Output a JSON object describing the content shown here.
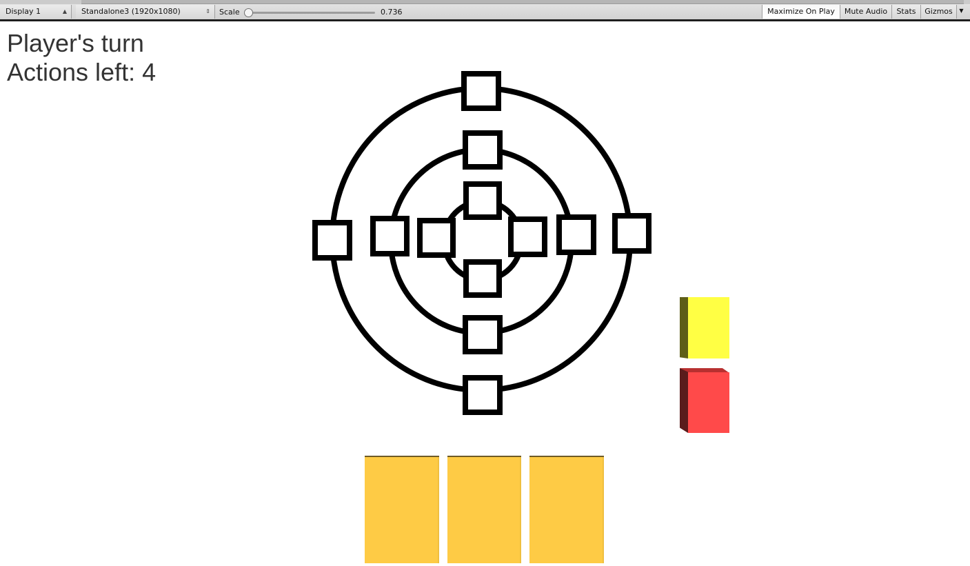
{
  "toolbar": {
    "display_label": "Display 1",
    "resolution_label": "Standalone3 (1920x1080)",
    "scale_label": "Scale",
    "scale_value": "0.736",
    "maximize_label": "Maximize On Play",
    "mute_label": "Mute Audio",
    "stats_label": "Stats",
    "gizmos_label": "Gizmos"
  },
  "hud": {
    "turn_text": "Player's turn",
    "actions_text": "Actions left: 4"
  },
  "colors": {
    "yellow_cube": "#ffff44",
    "red_cube": "#ff4a4a",
    "card": "#fecb45",
    "board_line": "#000000"
  },
  "hand": {
    "card_count": 3
  }
}
